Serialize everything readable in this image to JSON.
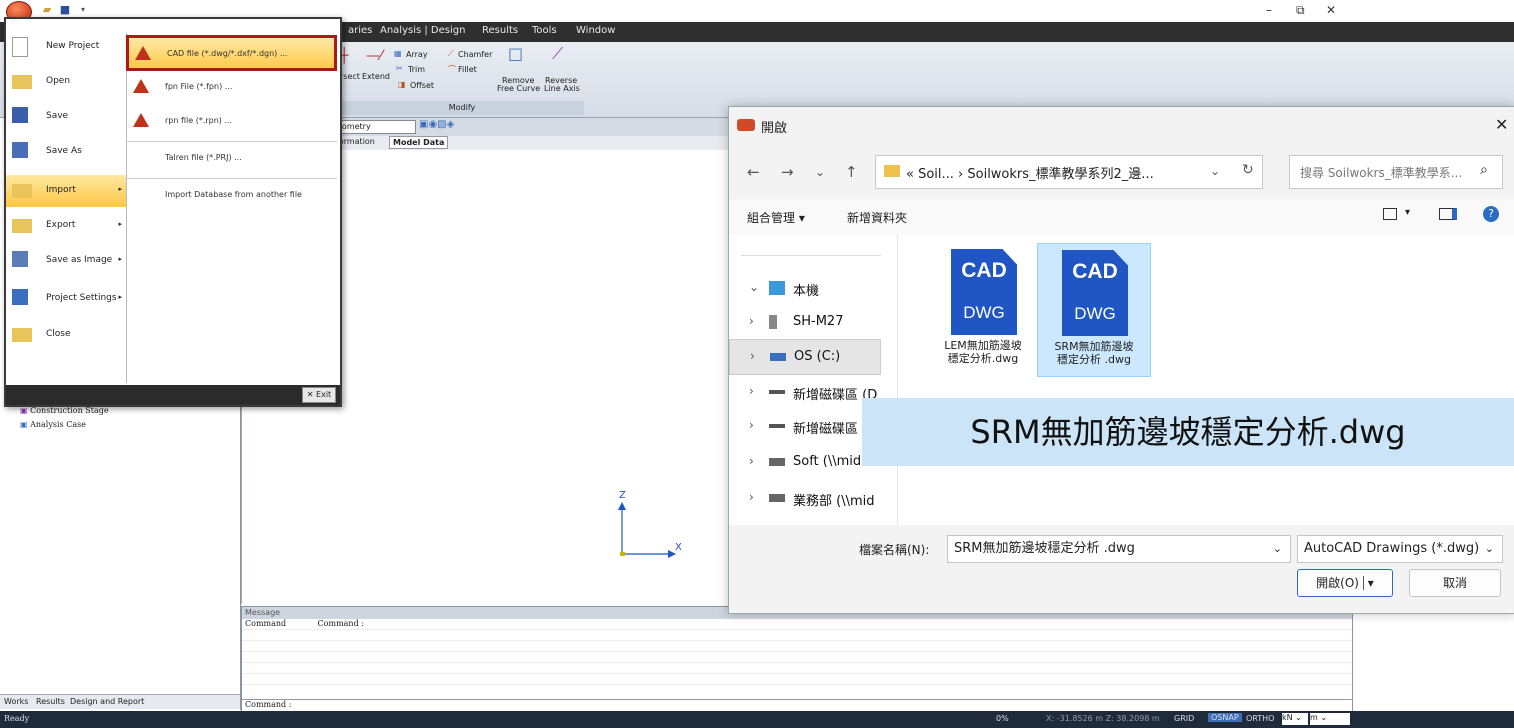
{
  "titlebar": {
    "minimize": "–",
    "restore": "⧉",
    "close": "✕"
  },
  "ribbon": {
    "tabs": [
      "aries",
      "Analysis | Design",
      "Results",
      "Tools",
      "Window"
    ],
    "tools": [
      "Array",
      "Chamfer",
      "Trim",
      "Fillet",
      "Offset",
      "rsect",
      "Extend",
      "Remove",
      "Free Curve",
      "Reverse",
      "Line Axis"
    ],
    "group": "Modify"
  },
  "view": {
    "combo": "eometry",
    "tabs": [
      "formation",
      "Model Data"
    ],
    "axis_z": "Z",
    "axis_x": "X"
  },
  "tree": {
    "items": [
      "Construction Stage",
      "Analysis Case"
    ]
  },
  "bottom_tabs": [
    "Works",
    "Results",
    "Design and Report"
  ],
  "message": {
    "title": "Message",
    "col1": "Command",
    "col2": "Command :",
    "input": "Command :"
  },
  "status": {
    "ready": "Ready",
    "coords": "X: -31.8526 m  Z: 38.2098 m",
    "grid": "GRID",
    "osnap": "OSNAP",
    "ortho": "ORTHO",
    "unit1": "kN",
    "unit2": "m",
    "zero": "0%"
  },
  "filemenu": {
    "items": [
      {
        "label": "New Project",
        "arrow": ""
      },
      {
        "label": "Open",
        "arrow": ""
      },
      {
        "label": "Save",
        "arrow": ""
      },
      {
        "label": "Save As",
        "arrow": ""
      },
      {
        "label": "Import",
        "arrow": "▸"
      },
      {
        "label": "Export",
        "arrow": "▸"
      },
      {
        "label": "Save as Image",
        "arrow": "▸"
      },
      {
        "label": "Project Settings",
        "arrow": "▸"
      },
      {
        "label": "Close",
        "arrow": ""
      }
    ],
    "sub": [
      "CAD file (*.dwg/*.dxf/*.dgn) ...",
      "fpn File (*.fpn) ...",
      "rpn file (*.rpn) ...",
      "Talren file (*.PRJ) ...",
      "Import Database from another file"
    ],
    "exit": "Exit"
  },
  "dialog": {
    "title": "開啟",
    "address": "«  Soil...  ›  Soilwokrs_標準教學系列2_邊...",
    "search_placeholder": "搜尋 Soilwokrs_標準教學系...",
    "organize": "組合管理 ▾",
    "new_folder": "新增資料夾",
    "tree": [
      {
        "chev": "⌄",
        "label": "本機"
      },
      {
        "chev": "›",
        "label": "SH-M27"
      },
      {
        "chev": "›",
        "label": "OS (C:)"
      },
      {
        "chev": "›",
        "label": "新增磁碟區 (D"
      },
      {
        "chev": "›",
        "label": "新增磁碟區"
      },
      {
        "chev": "›",
        "label": "Soft (\\\\mid"
      },
      {
        "chev": "›",
        "label": "業務部 (\\\\mid"
      }
    ],
    "files": [
      {
        "top": "CAD",
        "bottom": "DWG",
        "name1": "LEM無加筋邊坡",
        "name2": "穩定分析.dwg"
      },
      {
        "top": "CAD",
        "bottom": "DWG",
        "name1": "SRM無加筋邊坡",
        "name2": "穩定分析 .dwg"
      }
    ],
    "filename_label": "檔案名稱(N):",
    "filename": "SRM無加筋邊坡穩定分析 .dwg",
    "filetype": "AutoCAD Drawings (*.dwg)",
    "open": "開啟(O)",
    "cancel": "取消"
  },
  "zoom_caption": "SRM無加筋邊坡穩定分析.dwg"
}
